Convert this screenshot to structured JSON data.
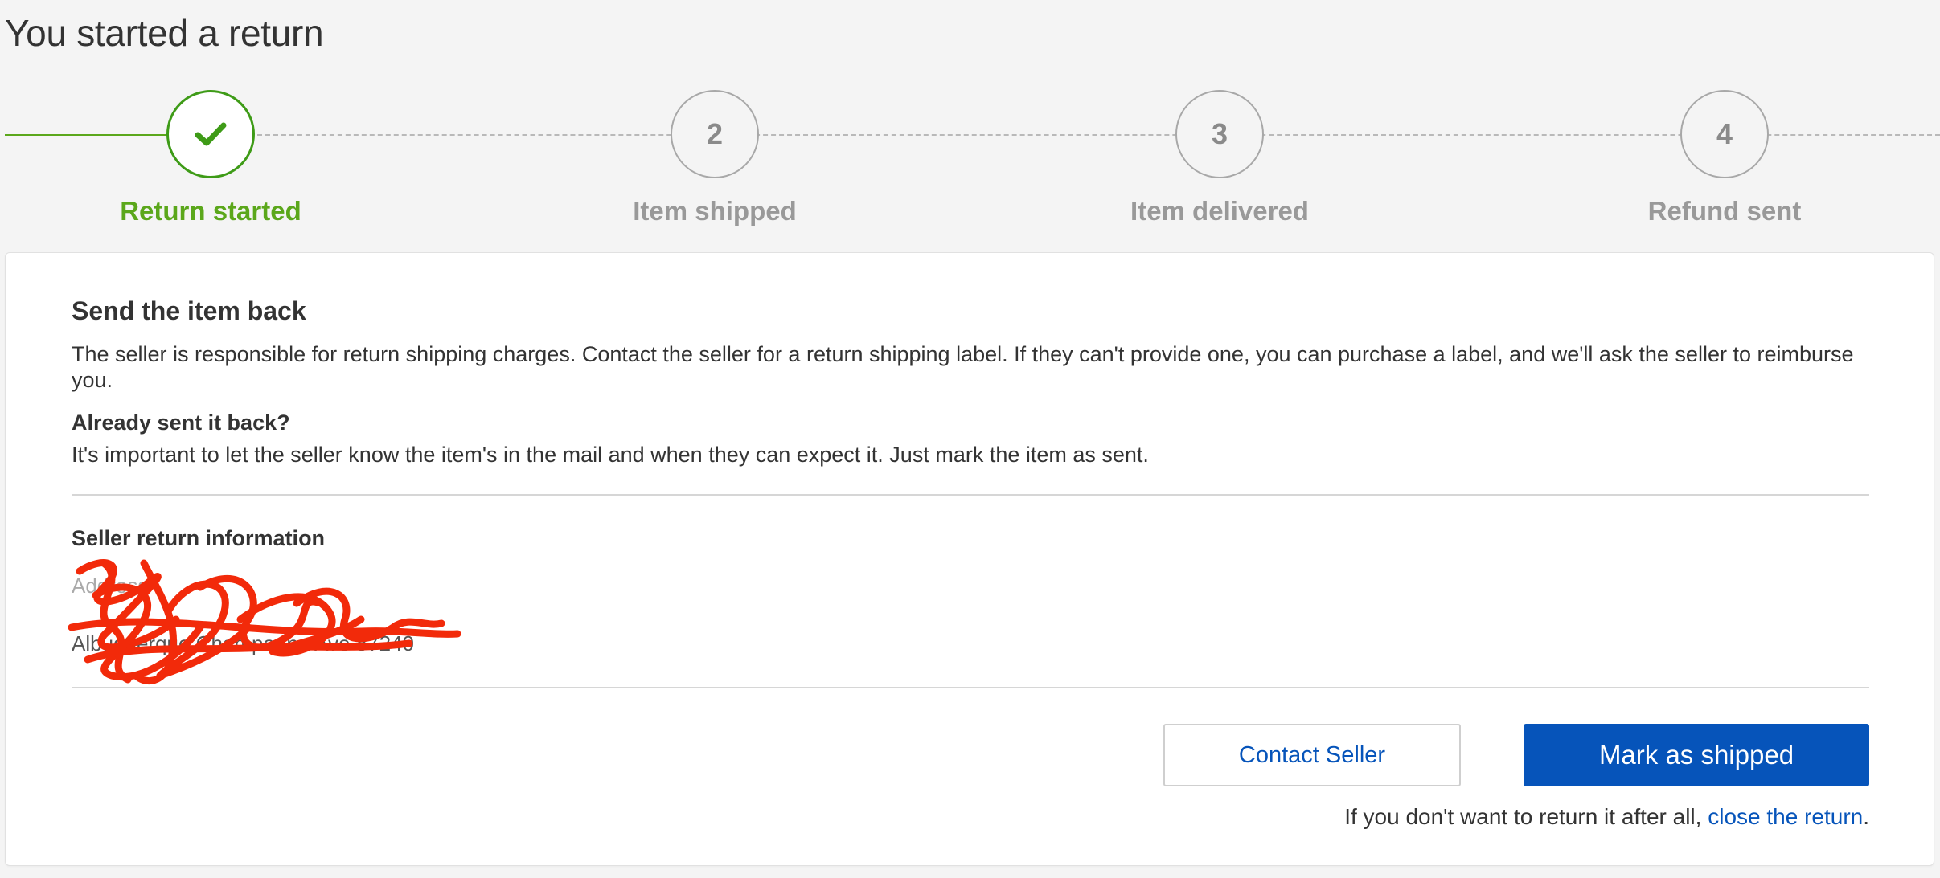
{
  "page": {
    "title": "You started a return"
  },
  "tracker": {
    "steps": [
      {
        "number": "✔",
        "label": "Return started",
        "state": "done"
      },
      {
        "number": "2",
        "label": "Item shipped",
        "state": "pending"
      },
      {
        "number": "3",
        "label": "Item delivered",
        "state": "pending"
      },
      {
        "number": "4",
        "label": "Refund sent",
        "state": "pending"
      }
    ],
    "active_color": "#5ba71b",
    "pending_color": "#999999"
  },
  "card": {
    "send_heading": "Send the item back",
    "send_text": "The seller is responsible for return shipping charges. Contact the seller for a return shipping label. If they can't provide one, you can purchase a label, and we'll ask the seller to reimburse you.",
    "already_heading": "Already sent it back?",
    "already_text": "It's important to let the seller know the item's in the mail and when they can expect it. Just mark the item as sent.",
    "seller_heading": "Seller return information",
    "address": {
      "label": "Address",
      "line2": "Albuquerque Champagne Ave 87240"
    },
    "contact_button": "Contact Seller",
    "mark_button": "Mark as shipped",
    "footer_prefix": "If you don't want to return it after all, ",
    "footer_link": "close the return",
    "footer_suffix": "."
  },
  "colors": {
    "primary_blue": "#0654ba",
    "success_green": "#5ba71b",
    "redaction_red": "#f22a0a"
  }
}
